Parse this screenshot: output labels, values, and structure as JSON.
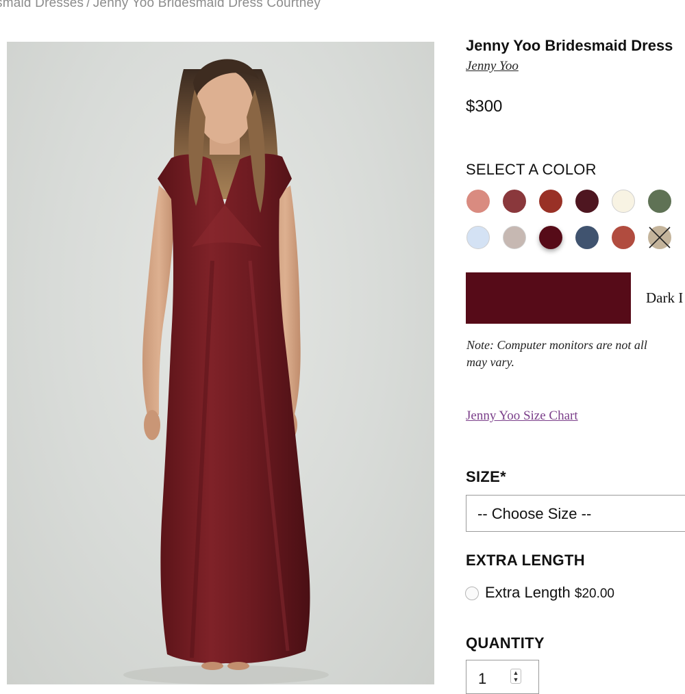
{
  "breadcrumb": {
    "parent": "smaid Dresses",
    "separator": "/",
    "current": "Jenny Yoo Bridesmaid Dress Courtney"
  },
  "product": {
    "title": "Jenny Yoo Bridesmaid Dress",
    "designer": "Jenny Yoo",
    "price": "$300",
    "image_alt": "Model wearing dark red satin cap-sleeve V-neck maxi bridesmaid dress"
  },
  "color_picker": {
    "heading": "SELECT A COLOR",
    "swatches": [
      {
        "color": "#d98b80"
      },
      {
        "color": "#8a383c"
      },
      {
        "color": "#993126"
      },
      {
        "color": "#4e1620"
      },
      {
        "color": "#f8f3e3"
      },
      {
        "color": "#5f7255"
      },
      {
        "color": "#d4e2f4"
      },
      {
        "color": "#c6b8b2"
      },
      {
        "color": "#560b18",
        "selected": true
      },
      {
        "color": "#40536f"
      },
      {
        "color": "#b14c3f"
      },
      {
        "color": "#c4b49b",
        "unavailable": true
      }
    ],
    "selected_color": "#560b18",
    "selected_name": "Dark I",
    "note_line1": "Note: Computer monitors are not all",
    "note_line2": "may vary."
  },
  "size_chart_link": "Jenny Yoo Size Chart",
  "size": {
    "label": "SIZE*",
    "selected": "-- Choose Size --"
  },
  "extra_length": {
    "label": "EXTRA LENGTH",
    "option_label": "Extra Length",
    "option_price": "$20.00"
  },
  "quantity": {
    "label": "QUANTITY",
    "value": "1",
    "spinner_up": "▲",
    "spinner_down": "▼"
  }
}
